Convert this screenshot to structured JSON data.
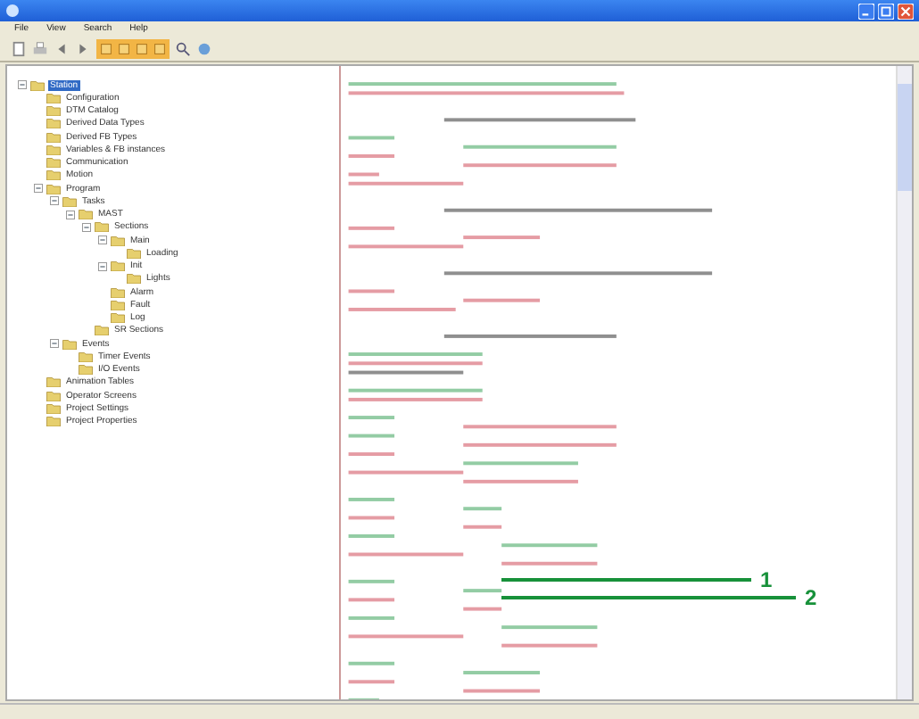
{
  "menu": [
    {
      "label": "File"
    },
    {
      "label": "View"
    },
    {
      "label": "Search"
    },
    {
      "label": "Help"
    }
  ],
  "tree": [
    {
      "label": "Station",
      "selected": true,
      "expanded": true,
      "children": [
        {
          "label": "Configuration",
          "selected": false
        },
        {
          "label": "DTM Catalog",
          "selected": false
        },
        {
          "label": "Derived Data Types",
          "selected": false
        },
        {
          "label": "Derived FB Types",
          "selected": false
        },
        {
          "label": "Variables & FB instances",
          "selected": false
        },
        {
          "label": "Communication",
          "selected": false
        },
        {
          "label": "Motion",
          "selected": false
        },
        {
          "label": "Program",
          "selected": false,
          "expanded": true,
          "children": [
            {
              "label": "Tasks",
              "selected": false,
              "expanded": true,
              "children": [
                {
                  "label": "MAST",
                  "selected": false,
                  "expanded": true,
                  "children": [
                    {
                      "label": "Sections",
                      "selected": false,
                      "expanded": true,
                      "children": [
                        {
                          "label": "Main",
                          "selected": false,
                          "expanded": true,
                          "children": [
                            {
                              "label": "Loading",
                              "selected": false
                            }
                          ]
                        },
                        {
                          "label": "Init",
                          "selected": false,
                          "expanded": true,
                          "children": [
                            {
                              "label": "Lights",
                              "selected": false
                            }
                          ]
                        },
                        {
                          "label": "Alarm",
                          "selected": false
                        },
                        {
                          "label": "Fault",
                          "selected": false
                        },
                        {
                          "label": "Log",
                          "selected": false
                        }
                      ]
                    },
                    {
                      "label": "SR Sections",
                      "selected": false
                    }
                  ]
                }
              ]
            },
            {
              "label": "Events",
              "selected": false,
              "expanded": true,
              "children": [
                {
                  "label": "Timer Events",
                  "selected": false
                },
                {
                  "label": "I/O Events",
                  "selected": false
                }
              ]
            }
          ]
        },
        {
          "label": "Animation Tables",
          "selected": false
        },
        {
          "label": "Operator Screens",
          "selected": false
        },
        {
          "label": "Project Settings",
          "selected": false
        },
        {
          "label": "Project Properties",
          "selected": false
        }
      ]
    }
  ],
  "callouts": [
    {
      "label": "1"
    },
    {
      "label": "2"
    }
  ]
}
